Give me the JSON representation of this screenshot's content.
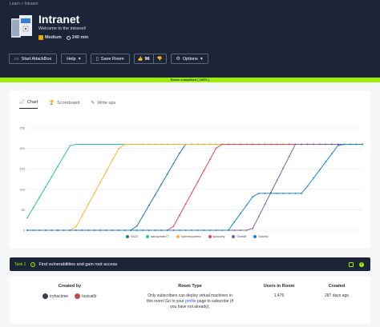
{
  "breadcrumb": {
    "home": "Learn",
    "sep": ">",
    "current": "Intranet"
  },
  "room": {
    "title": "Intranet",
    "subtitle": "Welcome to the intranet!",
    "difficulty": "Medium",
    "duration": "240 min"
  },
  "toolbar": {
    "attackbox": "Start AttackBox",
    "help": "Help",
    "save": "Save Room",
    "upvotes": "96",
    "options": "Options"
  },
  "progress": {
    "label": "Room completed ( 100% )",
    "percent": 100
  },
  "colors": {
    "dark": "#1c2538",
    "accent": "#9fef00"
  },
  "tabs": [
    {
      "label": "Chart",
      "icon": "chart-icon",
      "active": true
    },
    {
      "label": "Scoreboard",
      "icon": "trophy-icon",
      "active": false
    },
    {
      "label": "Write ups",
      "icon": "pen-icon",
      "active": false
    }
  ],
  "chart_data": {
    "type": "line",
    "title": "",
    "xlabel": "",
    "ylabel": "",
    "ylim": [
      0,
      250
    ],
    "yticks": [
      0,
      50,
      100,
      150,
      200,
      250
    ],
    "grid": true,
    "legend_position": "bottom",
    "series": [
      {
        "name": "N11C",
        "color": "#1f77b4",
        "start": 0.32,
        "plateau": 0.47,
        "x": [
          0,
          1
        ],
        "values": [
          0,
          210
        ]
      },
      {
        "name": "sandyman77",
        "color": "#26c6a2",
        "start": 0.0,
        "plateau": 0.13,
        "values": [
          30,
          210
        ]
      },
      {
        "name": "ryderecyclees",
        "color": "#f5b731",
        "start": 0.14,
        "plateau": 0.28,
        "values": [
          0,
          210
        ]
      },
      {
        "name": "spoochy",
        "color": "#e5484d",
        "start": 0.43,
        "plateau": 0.57,
        "values": [
          0,
          210
        ]
      },
      {
        "name": "Ootl48",
        "color": "#7e5fa8",
        "start": 0.67,
        "plateau": 0.8,
        "values": [
          0,
          210
        ]
      },
      {
        "name": "Subesl",
        "color": "#1a86d0",
        "start": 0.6,
        "plateau": 0.93,
        "values": [
          0,
          210
        ]
      }
    ]
  },
  "task": {
    "number": "Task 1",
    "title": "Find vulnerabilities and gain root access"
  },
  "info": {
    "created_by_label": "Created by",
    "creators": [
      "tryhackme",
      "toxicat0r"
    ],
    "room_type_label": "Room Type",
    "room_type_pre": "Only subscribers can deploy virtual machines in this room! Go to your ",
    "room_type_link": "profile",
    "room_type_post": " page to subscribe (if you have not already).",
    "users_label": "Users in Room",
    "users_value": "1,476",
    "created_label": "Created",
    "created_value": "287 days ago"
  }
}
